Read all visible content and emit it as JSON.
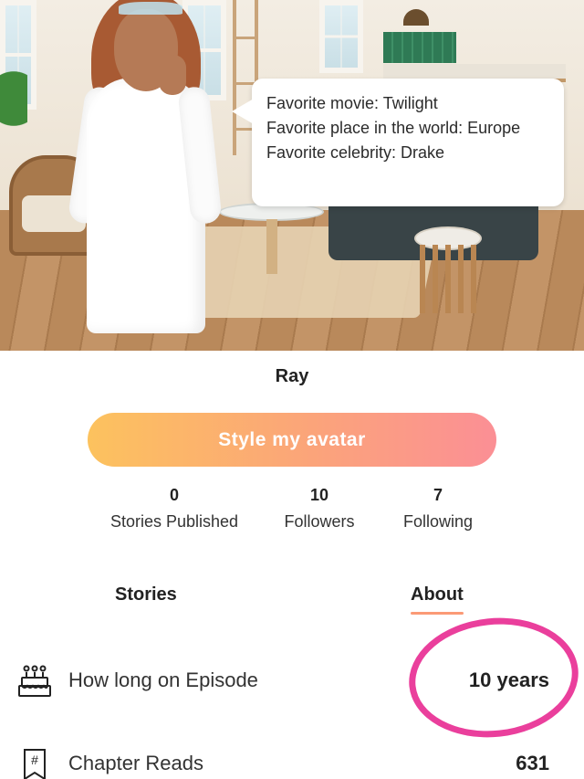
{
  "profile": {
    "username": "Ray",
    "bubble_lines": [
      "Favorite movie: Twilight",
      "Favorite place in the world: Europe",
      "Favorite celebrity: Drake"
    ],
    "style_button_label": "Style my avatar"
  },
  "stats": [
    {
      "value": "0",
      "label": "Stories Published"
    },
    {
      "value": "10",
      "label": "Followers"
    },
    {
      "value": "7",
      "label": "Following"
    }
  ],
  "tabs": {
    "stories": "Stories",
    "about": "About",
    "active": "about"
  },
  "about_rows": [
    {
      "icon": "birthday-cake-icon",
      "label": "How long on Episode",
      "value": "10 years"
    },
    {
      "icon": "hashtag-bookmark-icon",
      "label": "Chapter Reads",
      "value": "631"
    }
  ],
  "colors": {
    "button_gradient_start": "#fcc25e",
    "button_gradient_end": "#fb8f95",
    "tab_underline": "#fb9a76",
    "annotation_circle": "#ea3f9c"
  }
}
